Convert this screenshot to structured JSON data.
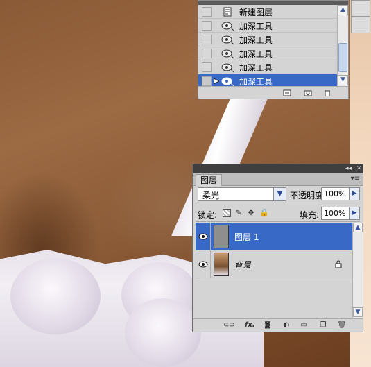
{
  "history_panel": {
    "items": [
      {
        "label": "新建图层",
        "icon": "new-layer-icon",
        "selected": false
      },
      {
        "label": "加深工具",
        "icon": "burn-tool-icon",
        "selected": false
      },
      {
        "label": "加深工具",
        "icon": "burn-tool-icon",
        "selected": false
      },
      {
        "label": "加深工具",
        "icon": "burn-tool-icon",
        "selected": false
      },
      {
        "label": "加深工具",
        "icon": "burn-tool-icon",
        "selected": false
      },
      {
        "label": "加深工具",
        "icon": "burn-tool-icon",
        "selected": true
      }
    ],
    "footer_icons": [
      "new-document-icon",
      "snapshot-camera-icon",
      "trash-icon"
    ]
  },
  "layers_panel": {
    "tab_label": "图层",
    "blend_mode": "柔光",
    "opacity_label": "不透明度:",
    "opacity_value": "100%",
    "lock_label": "锁定:",
    "fill_label": "填充:",
    "fill_value": "100%",
    "layers": [
      {
        "name": "图层 1",
        "selected": true,
        "visible": true,
        "locked": false
      },
      {
        "name": "背景",
        "selected": false,
        "visible": true,
        "locked": true
      }
    ],
    "footer_icons": [
      "link-icon",
      "fx-icon",
      "mask-icon",
      "adjustment-icon",
      "group-folder-icon",
      "new-layer-icon",
      "trash-icon"
    ]
  },
  "colors": {
    "selection": "#3869c6",
    "panel_bg": "#d4d4d4",
    "skin": "#8c5c38"
  }
}
